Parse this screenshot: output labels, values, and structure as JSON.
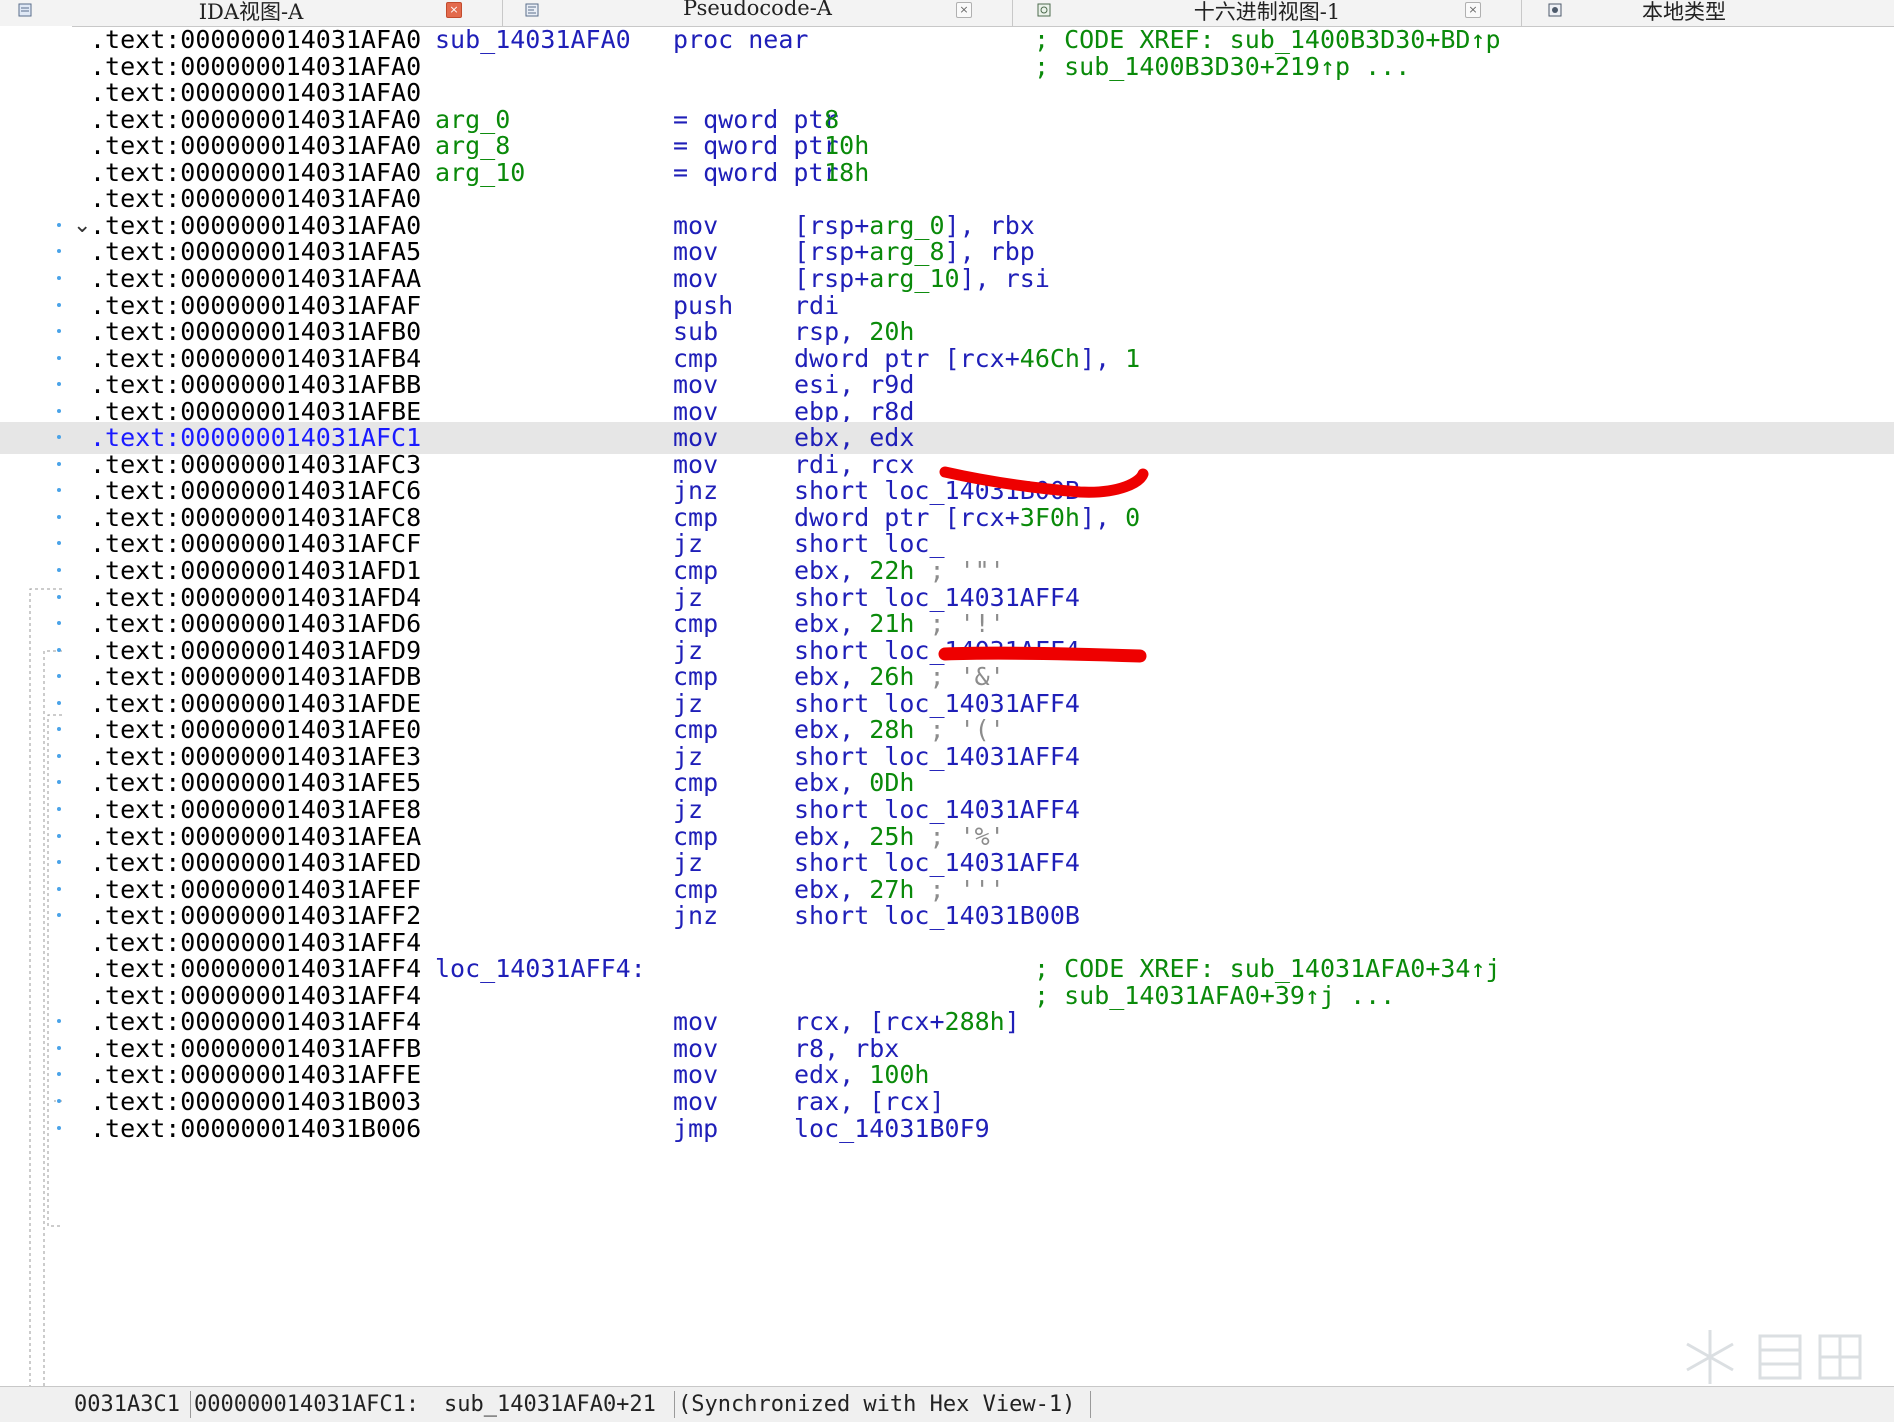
{
  "tabs": [
    {
      "title": "IDA视图-A",
      "icon": "ida-view-icon",
      "active": true,
      "closable": true
    },
    {
      "title": "Pseudocode-A",
      "icon": "pseudocode-icon",
      "active": false,
      "closable": true
    },
    {
      "title": "十六进制视图-1",
      "icon": "hex-view-icon",
      "active": false,
      "closable": true
    },
    {
      "title": "本地类型",
      "icon": "local-types-icon",
      "active": false,
      "closable": false
    }
  ],
  "listing": [
    {
      "addr": ".text:000000014031AFA0",
      "label": "sub_14031AFA0",
      "label_color": "blu",
      "mnem": "proc near",
      "ops": [],
      "cmt": [
        {
          "t": "; CODE XREF: sub_1400B3D30+BD↑p",
          "c": "grn"
        }
      ],
      "dot": false
    },
    {
      "addr": ".text:000000014031AFA0",
      "label": "",
      "mnem": "",
      "ops": [],
      "cmt": [
        {
          "t": "; sub_1400B3D30+219↑p ...",
          "c": "grn"
        }
      ],
      "dot": false
    },
    {
      "addr": ".text:000000014031AFA0",
      "label": "",
      "mnem": "",
      "ops": [],
      "cmt": [],
      "dot": false
    },
    {
      "addr": ".text:000000014031AFA0",
      "label": "arg_0",
      "label_color": "grn",
      "mnem": "= qword ptr",
      "mnem_color": "blu",
      "ops": [
        {
          "t": "  8",
          "c": "grn"
        }
      ],
      "cmt": [],
      "dot": false
    },
    {
      "addr": ".text:000000014031AFA0",
      "label": "arg_8",
      "label_color": "grn",
      "mnem": "= qword ptr",
      "ops": [
        {
          "t": "  10h",
          "c": "grn"
        }
      ],
      "cmt": [],
      "dot": false
    },
    {
      "addr": ".text:000000014031AFA0",
      "label": "arg_10",
      "label_color": "grn",
      "mnem": "= qword ptr",
      "ops": [
        {
          "t": "  18h",
          "c": "grn"
        }
      ],
      "cmt": [],
      "dot": false
    },
    {
      "addr": ".text:000000014031AFA0",
      "label": "",
      "mnem": "",
      "ops": [],
      "cmt": [],
      "dot": false
    },
    {
      "addr": ".text:000000014031AFA0",
      "label": "",
      "mnem": "mov",
      "ops": [
        {
          "t": "[rsp+",
          "c": "blu"
        },
        {
          "t": "arg_0",
          "c": "grn"
        },
        {
          "t": "], rbx",
          "c": "blu"
        }
      ],
      "cmt": [],
      "dot": true,
      "chevron": true
    },
    {
      "addr": ".text:000000014031AFA5",
      "label": "",
      "mnem": "mov",
      "ops": [
        {
          "t": "[rsp+",
          "c": "blu"
        },
        {
          "t": "arg_8",
          "c": "grn"
        },
        {
          "t": "], rbp",
          "c": "blu"
        }
      ],
      "cmt": [],
      "dot": true
    },
    {
      "addr": ".text:000000014031AFAA",
      "label": "",
      "mnem": "mov",
      "ops": [
        {
          "t": "[rsp+",
          "c": "blu"
        },
        {
          "t": "arg_10",
          "c": "grn"
        },
        {
          "t": "], rsi",
          "c": "blu"
        }
      ],
      "cmt": [],
      "dot": true
    },
    {
      "addr": ".text:000000014031AFAF",
      "label": "",
      "mnem": "push",
      "ops": [
        {
          "t": "rdi",
          "c": "blu"
        }
      ],
      "cmt": [],
      "dot": true
    },
    {
      "addr": ".text:000000014031AFB0",
      "label": "",
      "mnem": "sub",
      "ops": [
        {
          "t": "rsp, ",
          "c": "blu"
        },
        {
          "t": "20h",
          "c": "grn"
        }
      ],
      "cmt": [],
      "dot": true
    },
    {
      "addr": ".text:000000014031AFB4",
      "label": "",
      "mnem": "cmp",
      "ops": [
        {
          "t": "dword ptr [rcx+",
          "c": "blu"
        },
        {
          "t": "46Ch",
          "c": "grn"
        },
        {
          "t": "], ",
          "c": "blu"
        },
        {
          "t": "1",
          "c": "grn"
        }
      ],
      "cmt": [],
      "dot": true
    },
    {
      "addr": ".text:000000014031AFBB",
      "label": "",
      "mnem": "mov",
      "ops": [
        {
          "t": "esi, r9d",
          "c": "blu"
        }
      ],
      "cmt": [],
      "dot": true
    },
    {
      "addr": ".text:000000014031AFBE",
      "label": "",
      "mnem": "mov",
      "ops": [
        {
          "t": "ebp, r8d",
          "c": "blu"
        }
      ],
      "cmt": [],
      "dot": true
    },
    {
      "addr": ".text:000000014031AFC1",
      "label": "",
      "mnem": "mov",
      "ops": [
        {
          "t": "ebx, edx",
          "c": "blu"
        }
      ],
      "cmt": [],
      "dot": true,
      "current": true
    },
    {
      "addr": ".text:000000014031AFC3",
      "label": "",
      "mnem": "mov",
      "ops": [
        {
          "t": "rdi, rcx",
          "c": "blu"
        }
      ],
      "cmt": [],
      "dot": true
    },
    {
      "addr": ".text:000000014031AFC6",
      "label": "",
      "mnem": "jnz",
      "ops": [
        {
          "t": "short loc_14031B00B",
          "c": "blu"
        }
      ],
      "cmt": [],
      "dot": true
    },
    {
      "addr": ".text:000000014031AFC8",
      "label": "",
      "mnem": "cmp",
      "ops": [
        {
          "t": "dword ptr [rcx+",
          "c": "blu"
        },
        {
          "t": "3F0h",
          "c": "grn"
        },
        {
          "t": "], ",
          "c": "blu"
        },
        {
          "t": "0",
          "c": "grn"
        }
      ],
      "cmt": [],
      "dot": true
    },
    {
      "addr": ".text:000000014031AFCF",
      "label": "",
      "mnem": "jz",
      "ops": [
        {
          "t": "short loc_",
          "c": "blu"
        }
      ],
      "cmt": [],
      "dot": true
    },
    {
      "addr": ".text:000000014031AFD1",
      "label": "",
      "mnem": "cmp",
      "ops": [
        {
          "t": "ebx, ",
          "c": "blu"
        },
        {
          "t": "22h",
          "c": "grn"
        },
        {
          "t": " ; ",
          "c": "gry"
        },
        {
          "t": "'\"'",
          "c": "gry"
        }
      ],
      "cmt": [],
      "dot": true
    },
    {
      "addr": ".text:000000014031AFD4",
      "label": "",
      "mnem": "jz",
      "ops": [
        {
          "t": "short loc_14031AFF4",
          "c": "blu"
        }
      ],
      "cmt": [],
      "dot": true
    },
    {
      "addr": ".text:000000014031AFD6",
      "label": "",
      "mnem": "cmp",
      "ops": [
        {
          "t": "ebx, ",
          "c": "blu"
        },
        {
          "t": "21h",
          "c": "grn"
        },
        {
          "t": " ; ",
          "c": "gry"
        },
        {
          "t": "'!'",
          "c": "gry"
        }
      ],
      "cmt": [],
      "dot": true
    },
    {
      "addr": ".text:000000014031AFD9",
      "label": "",
      "mnem": "jz",
      "ops": [
        {
          "t": "short loc_14031AFF4",
          "c": "blu"
        }
      ],
      "cmt": [],
      "dot": true
    },
    {
      "addr": ".text:000000014031AFDB",
      "label": "",
      "mnem": "cmp",
      "ops": [
        {
          "t": "ebx, ",
          "c": "blu"
        },
        {
          "t": "26h",
          "c": "grn"
        },
        {
          "t": " ; ",
          "c": "gry"
        },
        {
          "t": "'&'",
          "c": "gry"
        }
      ],
      "cmt": [],
      "dot": true
    },
    {
      "addr": ".text:000000014031AFDE",
      "label": "",
      "mnem": "jz",
      "ops": [
        {
          "t": "short loc_14031AFF4",
          "c": "blu"
        }
      ],
      "cmt": [],
      "dot": true
    },
    {
      "addr": ".text:000000014031AFE0",
      "label": "",
      "mnem": "cmp",
      "ops": [
        {
          "t": "ebx, ",
          "c": "blu"
        },
        {
          "t": "28h",
          "c": "grn"
        },
        {
          "t": " ; ",
          "c": "gry"
        },
        {
          "t": "'('",
          "c": "gry"
        }
      ],
      "cmt": [],
      "dot": true
    },
    {
      "addr": ".text:000000014031AFE3",
      "label": "",
      "mnem": "jz",
      "ops": [
        {
          "t": "short loc_14031AFF4",
          "c": "blu"
        }
      ],
      "cmt": [],
      "dot": true
    },
    {
      "addr": ".text:000000014031AFE5",
      "label": "",
      "mnem": "cmp",
      "ops": [
        {
          "t": "ebx, ",
          "c": "blu"
        },
        {
          "t": "0Dh",
          "c": "grn"
        }
      ],
      "cmt": [],
      "dot": true
    },
    {
      "addr": ".text:000000014031AFE8",
      "label": "",
      "mnem": "jz",
      "ops": [
        {
          "t": "short loc_14031AFF4",
          "c": "blu"
        }
      ],
      "cmt": [],
      "dot": true
    },
    {
      "addr": ".text:000000014031AFEA",
      "label": "",
      "mnem": "cmp",
      "ops": [
        {
          "t": "ebx, ",
          "c": "blu"
        },
        {
          "t": "25h",
          "c": "grn"
        },
        {
          "t": " ; ",
          "c": "gry"
        },
        {
          "t": "'%'",
          "c": "gry"
        }
      ],
      "cmt": [],
      "dot": true
    },
    {
      "addr": ".text:000000014031AFED",
      "label": "",
      "mnem": "jz",
      "ops": [
        {
          "t": "short loc_14031AFF4",
          "c": "blu"
        }
      ],
      "cmt": [],
      "dot": true
    },
    {
      "addr": ".text:000000014031AFEF",
      "label": "",
      "mnem": "cmp",
      "ops": [
        {
          "t": "ebx, ",
          "c": "blu"
        },
        {
          "t": "27h",
          "c": "grn"
        },
        {
          "t": " ; ",
          "c": "gry"
        },
        {
          "t": "'''",
          "c": "gry"
        }
      ],
      "cmt": [],
      "dot": true
    },
    {
      "addr": ".text:000000014031AFF2",
      "label": "",
      "mnem": "jnz",
      "ops": [
        {
          "t": "short loc_14031B00B",
          "c": "blu"
        }
      ],
      "cmt": [],
      "dot": true
    },
    {
      "addr": ".text:000000014031AFF4",
      "label": "",
      "mnem": "",
      "ops": [],
      "cmt": [],
      "dot": false
    },
    {
      "addr": ".text:000000014031AFF4",
      "label": "loc_14031AFF4:",
      "label_color": "blu",
      "mnem": "",
      "ops": [],
      "cmt": [
        {
          "t": "; CODE XREF: sub_14031AFA0+34↑j",
          "c": "grn"
        }
      ],
      "dot": false
    },
    {
      "addr": ".text:000000014031AFF4",
      "label": "",
      "mnem": "",
      "ops": [],
      "cmt": [
        {
          "t": "; sub_14031AFA0+39↑j ...",
          "c": "grn"
        }
      ],
      "dot": false
    },
    {
      "addr": ".text:000000014031AFF4",
      "label": "",
      "mnem": "mov",
      "ops": [
        {
          "t": "rcx, [rcx+",
          "c": "blu"
        },
        {
          "t": "288h",
          "c": "grn"
        },
        {
          "t": "]",
          "c": "blu"
        }
      ],
      "cmt": [],
      "dot": true
    },
    {
      "addr": ".text:000000014031AFFB",
      "label": "",
      "mnem": "mov",
      "ops": [
        {
          "t": "r8, rbx",
          "c": "blu"
        }
      ],
      "cmt": [],
      "dot": true
    },
    {
      "addr": ".text:000000014031AFFE",
      "label": "",
      "mnem": "mov",
      "ops": [
        {
          "t": "edx, ",
          "c": "blu"
        },
        {
          "t": "100h",
          "c": "grn"
        }
      ],
      "cmt": [],
      "dot": true
    },
    {
      "addr": ".text:000000014031B003",
      "label": "",
      "mnem": "mov",
      "ops": [
        {
          "t": "rax, [rcx]",
          "c": "blu"
        }
      ],
      "cmt": [],
      "dot": true
    },
    {
      "addr": ".text:000000014031B006",
      "label": "",
      "mnem": "jmp",
      "ops": [
        {
          "t": "loc_14031B0F9",
          "c": "blu"
        }
      ],
      "cmt": [],
      "dot": true
    }
  ],
  "status": {
    "offset": "0031A3C1",
    "address": "000000014031AFC1:",
    "location": "sub_14031AFA0+21",
    "sync": "(Synchronized with Hex View-1)"
  },
  "watermark_icon": "kanxue-logo-icon"
}
